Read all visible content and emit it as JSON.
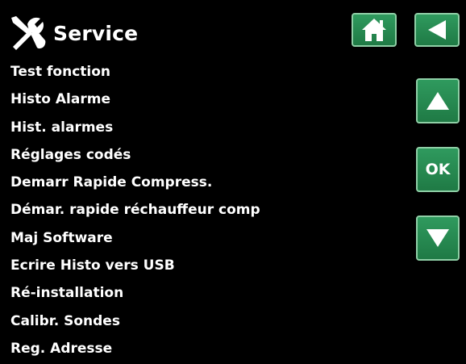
{
  "header": {
    "title": "Service",
    "icon": "tools-icon"
  },
  "menu": {
    "items": [
      {
        "label": "Test fonction"
      },
      {
        "label": "Histo Alarme"
      },
      {
        "label": "Hist. alarmes"
      },
      {
        "label": "Réglages codés"
      },
      {
        "label": "Demarr Rapide Compress."
      },
      {
        "label": "Démar. rapide réchauffeur comp"
      },
      {
        "label": "Maj Software"
      },
      {
        "label": "Ecrire Histo vers USB"
      },
      {
        "label": "Ré-installation"
      },
      {
        "label": "Calibr. Sondes"
      },
      {
        "label": "Reg. Adresse"
      }
    ]
  },
  "buttons": {
    "home_icon": "home-icon",
    "back_icon": "triangle-left-icon",
    "up_icon": "triangle-up-icon",
    "ok_label": "OK",
    "down_icon": "triangle-down-icon"
  },
  "colors": {
    "background": "#000000",
    "text": "#ffffff",
    "button_green": "#239052",
    "button_border": "#8fcfa6"
  }
}
